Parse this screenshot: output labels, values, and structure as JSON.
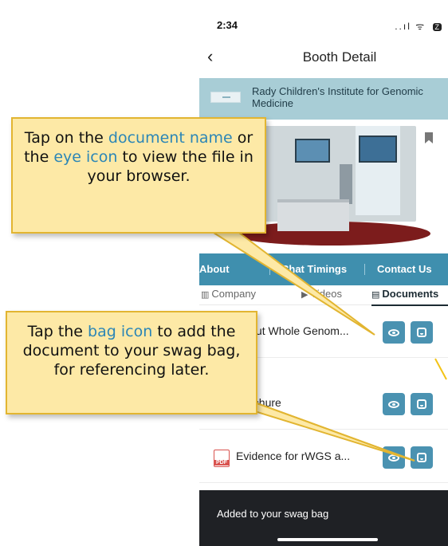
{
  "status_bar": {
    "time": "2:34",
    "signal_icons": "..ıl ᯤ",
    "battery": "Z"
  },
  "nav": {
    "title": "Booth Detail",
    "back_icon": "chevron-left-icon"
  },
  "booth": {
    "name": "Rady Children's Institute for Genomic Medicine",
    "banner_color": "#a8cdd6"
  },
  "action_tabs": [
    "About",
    "Chat Timings",
    "Contact Us"
  ],
  "content_tabs": {
    "company": "Company",
    "videos": "Videos",
    "documents": "Documents",
    "active": "Documents"
  },
  "documents": [
    {
      "name": "About Whole Genom..."
    },
    {
      "name": "Brochure"
    },
    {
      "name": "Evidence for rWGS a..."
    }
  ],
  "toast": {
    "message": "Added to your swag bag"
  },
  "callouts": {
    "view": {
      "pre1": "Tap on the ",
      "hl1": "document name",
      "mid": " or the ",
      "hl2": "eye icon",
      "post": " to view the file in your browser."
    },
    "bag": {
      "pre": "Tap the ",
      "hl": "bag icon",
      "post": " to add the document to your swag bag, for referencing later."
    }
  },
  "colors": {
    "accent": "#4a92b1",
    "tab_bar": "#3f8fae",
    "highlight": "#f3c316",
    "callout_bg": "#fde9a6",
    "callout_highlight": "#2c86b6",
    "pdf_red": "#d9534f"
  }
}
